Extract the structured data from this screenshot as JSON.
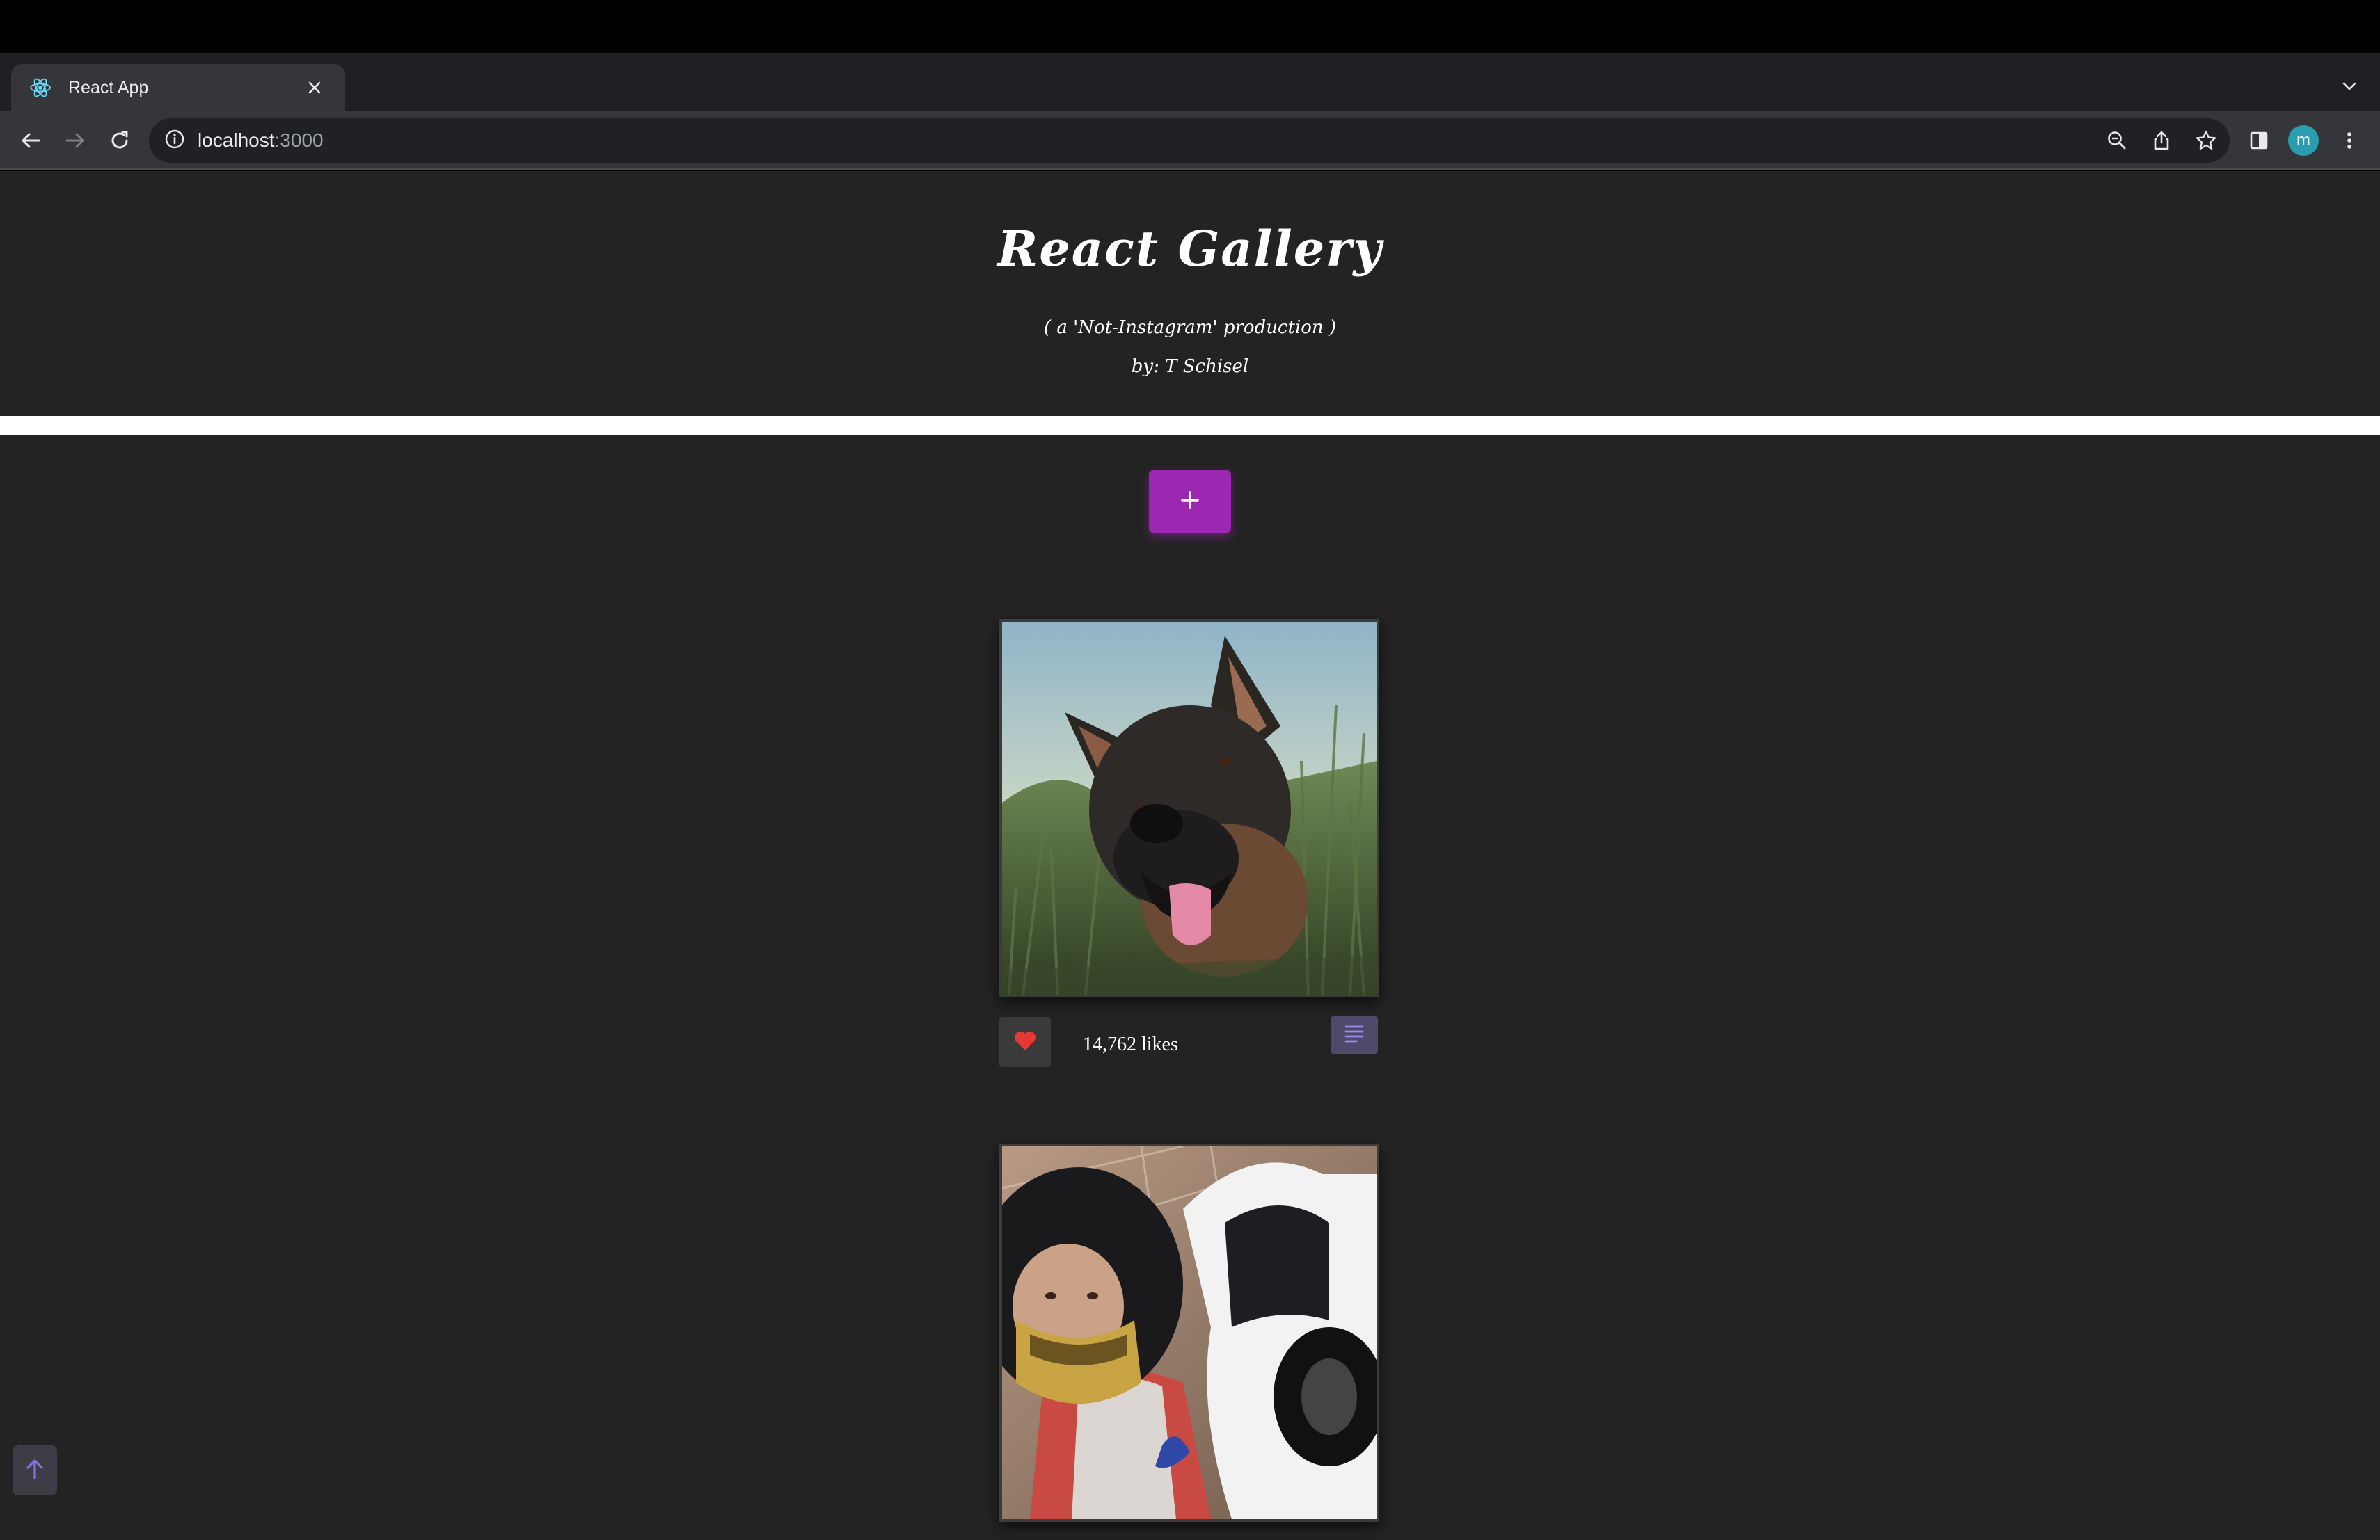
{
  "browser": {
    "tab_title": "React App",
    "url_host": "localhost",
    "url_port": ":3000",
    "avatar_letter": "m"
  },
  "header": {
    "title": "React Gallery",
    "subtitle": "( a 'Not-Instagram' production )",
    "byline": "by: T Schisel"
  },
  "add_button": {
    "icon": "plus-icon"
  },
  "posts": [
    {
      "likes": "14,762 likes",
      "like_icon": "heart-icon",
      "description_icon": "description-icon"
    }
  ],
  "colors": {
    "page_background": "#232323",
    "add_button": "#9c27b0",
    "heart": "#e53935",
    "description_button": "#4d4a6b"
  }
}
